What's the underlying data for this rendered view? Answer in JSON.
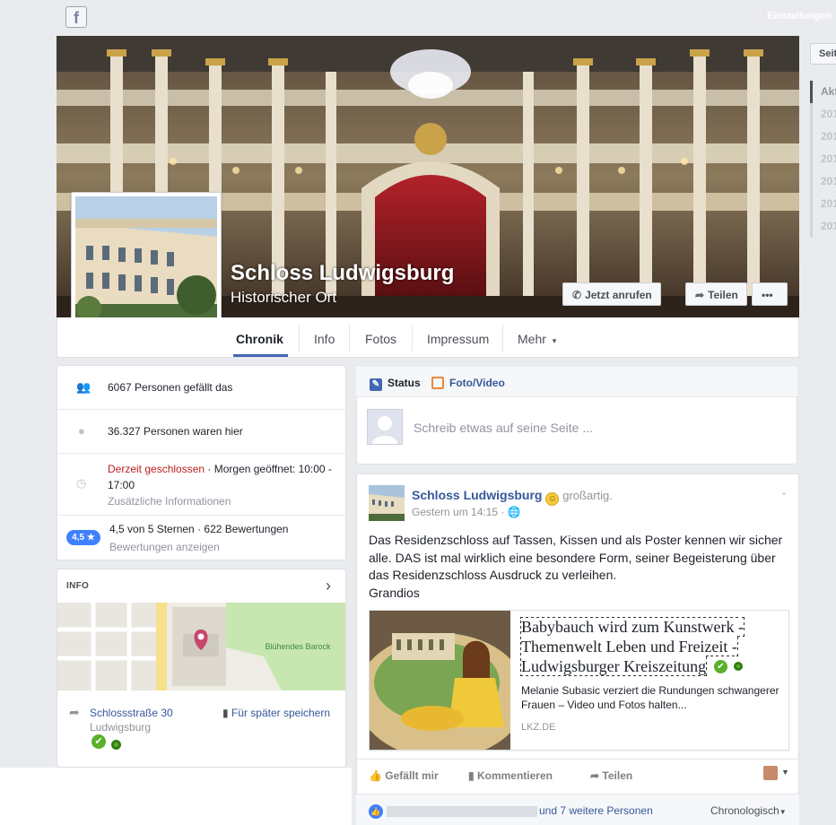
{
  "topbar": {
    "logo": "f",
    "settings_label": "Einstellungen"
  },
  "right_rail": {
    "button_label": "Seit",
    "years": [
      "Akt",
      "201",
      "201",
      "201",
      "201",
      "201",
      "201"
    ]
  },
  "page": {
    "name": "Schloss Ludwigsburg",
    "category": "Historischer Ort"
  },
  "cover_buttons": {
    "call": "Jetzt anrufen",
    "share": "Teilen",
    "more": "•••"
  },
  "tabs": [
    {
      "label": "Chronik"
    },
    {
      "label": "Info"
    },
    {
      "label": "Fotos"
    },
    {
      "label": "Impressum"
    },
    {
      "label": "Mehr"
    }
  ],
  "tabs_more_arrow": "▾",
  "about": {
    "likes": "6067 Personen gefällt das",
    "checkins": "36.327 Personen waren hier",
    "status_closed": "Derzeit geschlossen",
    "status_hours_line1": " · Morgen geöffnet: 10:00 -",
    "status_hours_line2": "17:00",
    "more_info": "Zusätzliche Informationen",
    "rating_badge": "4,5 ★",
    "rating": "4,5 von 5 Sternen · 622 Bewertungen",
    "reviews_link": "Bewertungen anzeigen"
  },
  "info": {
    "title": "INFO",
    "map_label": "Blühendes Barock",
    "street": "Schlossstraße 30",
    "city": "Ludwigsburg",
    "save_label": "Für später speichern"
  },
  "composer": {
    "status_tab": "Status",
    "photo_tab": "Foto/Video",
    "placeholder": "Schreib etwas auf seine Seite ..."
  },
  "post": {
    "author": "Schloss Ludwigsburg",
    "feeling": "großartig.",
    "time": "Gestern um 14:15 ·",
    "text_lines": [
      "Das Residenzschloss auf Tassen, Kissen und als Poster kennen wir sicher",
      "alle. DAS ist mal wirklich eine besondere Form, seiner Begeisterung über",
      "das Residenzschloss Ausdruck zu verleihen.",
      "Grandios"
    ],
    "link": {
      "title": "Babybauch wird zum Kunstwerk - Themenwelt Leben und Freizeit - Ludwigsburger Kreiszeitung",
      "desc": "Melanie Subasic verziert die Rundungen schwangerer Frauen – Video und Fotos halten...",
      "domain": "LKZ.DE"
    },
    "actions": {
      "like": "Gefällt mir",
      "comment": "Kommentieren",
      "share": "Teilen"
    },
    "likes_text": "und 7 weitere Personen",
    "order": "Chronologisch"
  },
  "colors": {
    "accent": "#4267b2",
    "link": "#365899",
    "closed_red": "#be1f1f",
    "badge_blue": "#4080ff"
  }
}
